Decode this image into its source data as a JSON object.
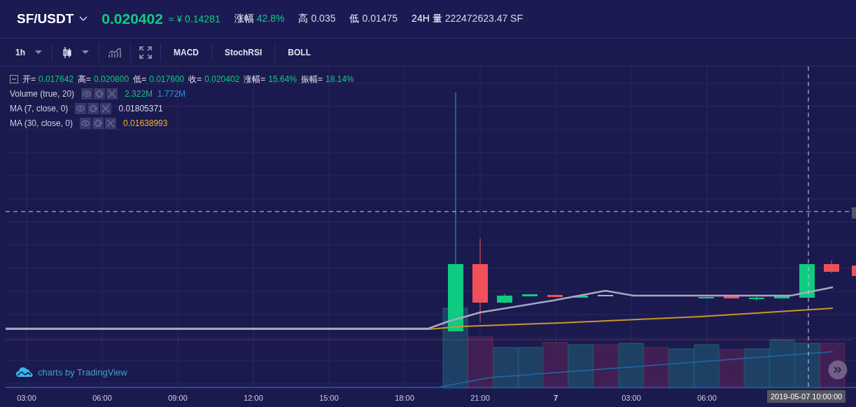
{
  "header": {
    "pair": "SF/USDT",
    "price": "0.020402",
    "approx": "≈ ¥ 0.14281",
    "stats": [
      {
        "label": "涨幅",
        "value": "42.8%",
        "kind": "up"
      },
      {
        "label": "高",
        "value": "0.035",
        "kind": "plain"
      },
      {
        "label": "低",
        "value": "0.01475",
        "kind": "plain"
      },
      {
        "label": "24H 量",
        "value": "222472623.47 SF",
        "kind": "plain"
      }
    ]
  },
  "toolbar": [
    {
      "kind": "select",
      "label": "1h"
    },
    {
      "kind": "chart-type"
    },
    {
      "kind": "indicators"
    },
    {
      "kind": "fullscreen"
    },
    {
      "kind": "study",
      "label": "MACD"
    },
    {
      "kind": "study",
      "label": "StochRSI"
    },
    {
      "kind": "study",
      "label": "BOLL"
    }
  ],
  "legend": {
    "ohlc": [
      {
        "label": "开=",
        "value": "0.017642"
      },
      {
        "label": "高=",
        "value": "0.020800"
      },
      {
        "label": "低=",
        "value": "0.017600"
      },
      {
        "label": "收=",
        "value": "0.020402"
      },
      {
        "label": "涨幅=",
        "value": "15.64%"
      },
      {
        "label": "振幅=",
        "value": "18.14%"
      }
    ],
    "studies": [
      {
        "name": "Volume (true, 20)",
        "values": [
          {
            "text": "2.322M",
            "color": "#1fbf8f"
          },
          {
            "text": "1.772M",
            "color": "#2f8fe0"
          }
        ]
      },
      {
        "name": "MA (7, close, 0)",
        "values": [
          {
            "text": "0.01805371",
            "color": "#d6d6e6"
          }
        ]
      },
      {
        "name": "MA (30, close, 0)",
        "values": [
          {
            "text": "0.01638993",
            "color": "#f0b429"
          }
        ]
      }
    ]
  },
  "branding": "charts by TradingView",
  "x_axis": [
    {
      "label": "03:00",
      "kind": "time"
    },
    {
      "label": "06:00",
      "kind": "time"
    },
    {
      "label": "09:00",
      "kind": "time"
    },
    {
      "label": "12:00",
      "kind": "time"
    },
    {
      "label": "15:00",
      "kind": "time"
    },
    {
      "label": "18:00",
      "kind": "time"
    },
    {
      "label": "21:00",
      "kind": "time"
    },
    {
      "label": "7",
      "kind": "day"
    },
    {
      "label": "03:00",
      "kind": "time"
    },
    {
      "label": "06:00",
      "kind": "time"
    }
  ],
  "crosshair_time": "2019-05-07 10:00:00"
}
